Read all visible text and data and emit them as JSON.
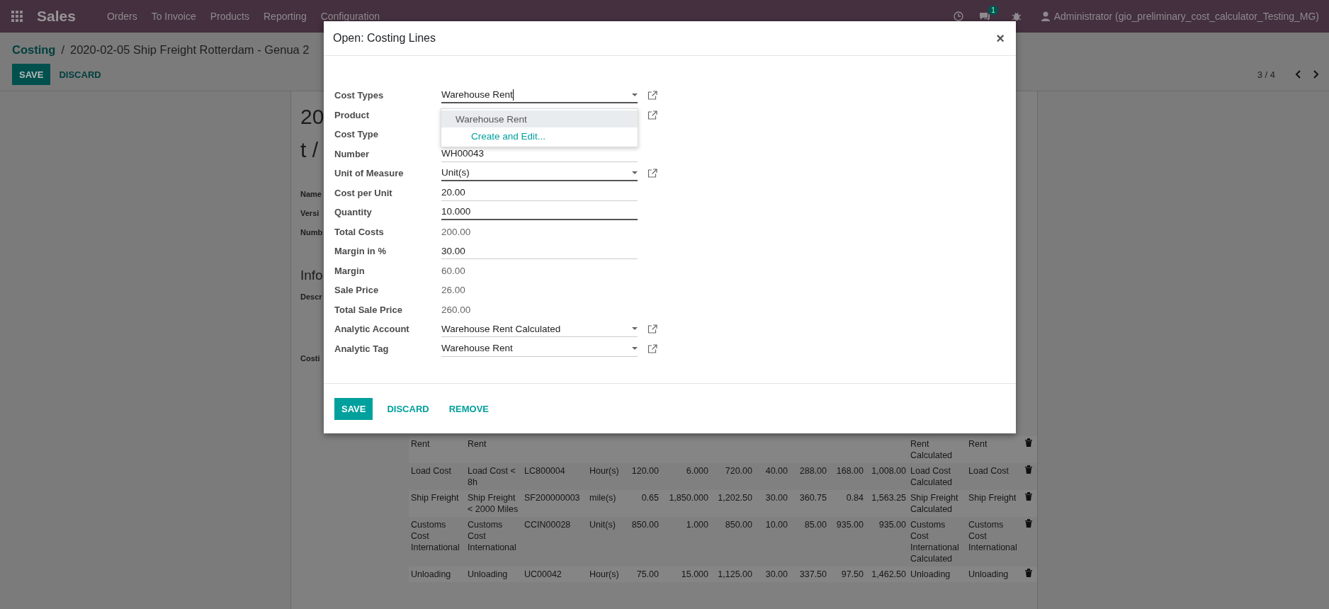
{
  "navbar": {
    "app_name": "Sales",
    "menu": [
      "Orders",
      "To Invoice",
      "Products",
      "Reporting",
      "Configuration"
    ],
    "messages_badge": "1",
    "user": "Administrator (gio_preliminary_cost_calculator_Testing_MG)"
  },
  "breadcrumb": {
    "parent": "Costing",
    "separator": "/",
    "current": "2020-02-05 Ship Freight Rotterdam - Genua 2"
  },
  "actions": [
    {
      "label": "SAVE",
      "kind": "primary"
    },
    {
      "label": "DISCARD",
      "kind": "link"
    }
  ],
  "pager": {
    "text": "3 / 4"
  },
  "record": {
    "title_lines": [
      "20",
      "t /"
    ],
    "labels": [
      "Name",
      "Versi",
      "Numb"
    ],
    "section": "Info",
    "section_labels": [
      "Descr"
    ],
    "lines_label": "Costi"
  },
  "lines": [
    {
      "column_1": "Rent",
      "column_2": "Rent",
      "column_12": "Rent Calculated",
      "column_13": "Rent"
    },
    {
      "column_1": "Load Cost",
      "column_2": "Load Cost < 8h",
      "column_3": "LC800004",
      "column_4": "Hour(s)",
      "column_5": "120.00",
      "column_6": "6.000",
      "column_7": "720.00",
      "column_8": "40.00",
      "column_9": "288.00",
      "column_10": "168.00",
      "column_11": "1,008.00",
      "column_12": "Load Cost Calculated",
      "column_13": "Load Cost"
    },
    {
      "column_1": "Ship Freight",
      "column_2": "Ship Freight < 2000 Miles",
      "column_3": "SF200000003",
      "column_4": "mile(s)",
      "column_5": "0.65",
      "column_6": "1,850.000",
      "column_7": "1,202.50",
      "column_8": "30.00",
      "column_9": "360.75",
      "column_10": "0.84",
      "column_11": "1,563.25",
      "column_12": "Ship Freight Calculated",
      "column_13": "Ship Freight"
    },
    {
      "column_1": "Customs Cost International",
      "column_2": "Customs Cost International",
      "column_3": "CCIN00028",
      "column_4": "Unit(s)",
      "column_5": "850.00",
      "column_6": "1.000",
      "column_7": "850.00",
      "column_8": "10.00",
      "column_9": "85.00",
      "column_10": "935.00",
      "column_11": "935.00",
      "column_12": "Customs Cost International Calculated",
      "column_13": "Customs Cost International"
    },
    {
      "column_1": "Unloading",
      "column_2": "Unloading",
      "column_3": "UC00042",
      "column_4": "Hour(s)",
      "column_5": "75.00",
      "column_6": "15.000",
      "column_7": "1,125.00",
      "column_8": "30.00",
      "column_9": "337.50",
      "column_10": "97.50",
      "column_11": "1,462.50",
      "column_12": "Unloading",
      "column_13": "Unloading"
    }
  ],
  "dialog": {
    "title": "Open: Costing Lines",
    "close": "×",
    "fields": [
      {
        "label": "Cost Types",
        "kind": "many2one",
        "value": "Warehouse Rent",
        "active": true,
        "typing": true
      },
      {
        "label": "Product",
        "kind": "many2one"
      },
      {
        "label": "Cost Type",
        "kind": "char"
      },
      {
        "label": "Number",
        "kind": "char",
        "value": "WH00043",
        "active": false,
        "typing": false
      },
      {
        "label": "Unit of Measure",
        "kind": "many2one",
        "value": "Unit(s)",
        "active": true,
        "typing": false
      },
      {
        "label": "Cost per Unit",
        "kind": "char",
        "value": "20.00",
        "active": false,
        "typing": false
      },
      {
        "label": "Quantity",
        "kind": "char",
        "value": "10.000",
        "active": true,
        "typing": false
      },
      {
        "label": "Total Costs",
        "kind": "readonly",
        "value": "200.00"
      },
      {
        "label": "Margin in %",
        "kind": "char",
        "value": "30.00",
        "active": false,
        "typing": false
      },
      {
        "label": "Margin",
        "kind": "readonly",
        "value": "60.00"
      },
      {
        "label": "Sale Price",
        "kind": "readonly",
        "value": "26.00"
      },
      {
        "label": "Total Sale Price",
        "kind": "readonly",
        "value": "260.00"
      },
      {
        "label": "Analytic Account",
        "kind": "many2one",
        "value": "Warehouse Rent Calculated",
        "active": false,
        "typing": false
      },
      {
        "label": "Analytic Tag",
        "kind": "many2one",
        "value": "Warehouse Rent",
        "active": false,
        "typing": false
      }
    ],
    "dropdown": [
      {
        "label": "Warehouse Rent",
        "kind": "option",
        "selected": true
      },
      {
        "label": "Create and Edit...",
        "kind": "action",
        "selected": false
      }
    ],
    "buttons": [
      {
        "label": "SAVE",
        "kind": "primary"
      },
      {
        "label": "DISCARD",
        "kind": "link"
      },
      {
        "label": "REMOVE",
        "kind": "link"
      }
    ]
  }
}
